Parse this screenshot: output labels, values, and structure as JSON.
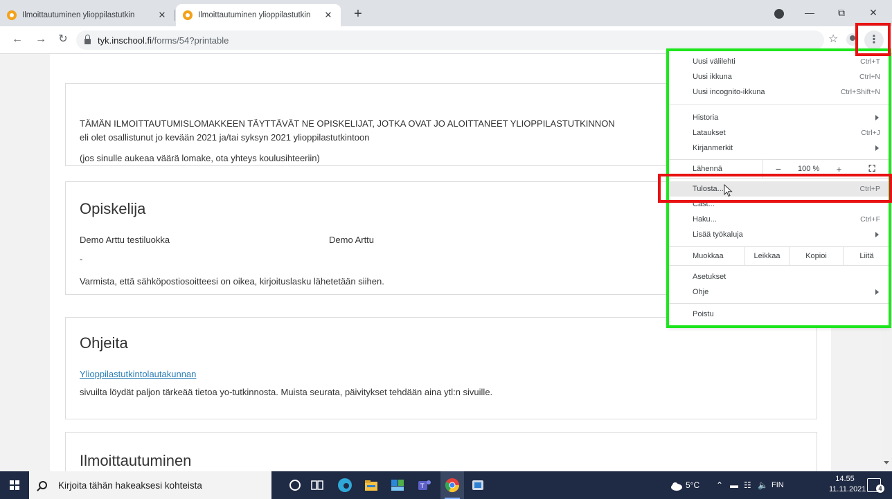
{
  "browser": {
    "tabs": [
      {
        "title": "Ilmoittautuminen ylioppilastutkin",
        "active": false
      },
      {
        "title": "Ilmoittautuminen ylioppilastutkin",
        "active": true
      }
    ],
    "tab_close_glyph": "✕",
    "new_tab_glyph": "+",
    "url_host": "tyk.inschool.fi",
    "url_path": "/forms/54?printable",
    "icons": [
      "back-icon",
      "forward-icon",
      "reload-icon",
      "lock-icon",
      "star-icon",
      "account-icon",
      "kebab-menu-icon",
      "minimize-icon",
      "restore-icon",
      "close-window-icon"
    ],
    "highlight_colors": {
      "red": "#e81212",
      "green": "#1ee61e"
    }
  },
  "page": {
    "intro": {
      "line1": "TÄMÄN ILMOITTAUTUMISLOMAKKEEN TÄYTTÄVÄT NE OPISKELIJAT, JOTKA OVAT JO ALOITTANEET YLIOPPILASTUTKINNON",
      "line2": "eli olet osallistunut jo kevään 2021 ja/tai syksyn 2021 ylioppilastutkintoon",
      "line3": "(jos sinulle aukeaa väärä lomake, ota yhteys koulusihteeriin)"
    },
    "student": {
      "heading": "Opiskelija",
      "class_name": "Demo Arttu testiluokka",
      "name": "Demo Arttu",
      "dash": "-",
      "email_note": "Varmista, että sähköpostiosoitteesi on oikea, kirjoituslasku lähetetään siihen."
    },
    "instructions": {
      "heading": "Ohjeita",
      "link": "Ylioppilastutkintolautakunnan",
      "text": "sivuilta löydät paljon tärkeää tietoa yo-tutkinnosta. Muista seurata, päivitykset tehdään aina ytl:n sivuille."
    },
    "registration": {
      "heading": "Ilmoittautuminen"
    }
  },
  "menu": {
    "new_tab": {
      "label": "Uusi välilehti",
      "shortcut": "Ctrl+T"
    },
    "new_window": {
      "label": "Uusi ikkuna",
      "shortcut": "Ctrl+N"
    },
    "incognito": {
      "label": "Uusi incognito-ikkuna",
      "shortcut": "Ctrl+Shift+N"
    },
    "history": {
      "label": "Historia"
    },
    "downloads": {
      "label": "Lataukset",
      "shortcut": "Ctrl+J"
    },
    "bookmarks": {
      "label": "Kirjanmerkit"
    },
    "zoom": {
      "label": "Lähennä",
      "minus": "−",
      "value": "100 %",
      "plus": "+"
    },
    "print": {
      "label": "Tulosta...",
      "shortcut": "Ctrl+P"
    },
    "cast": {
      "label": "Cast..."
    },
    "find": {
      "label": "Haku...",
      "shortcut": "Ctrl+F"
    },
    "more_tools": {
      "label": "Lisää työkaluja"
    },
    "edit": {
      "label": "Muokkaa",
      "cut": "Leikkaa",
      "copy": "Kopioi",
      "paste": "Liitä"
    },
    "settings": {
      "label": "Asetukset"
    },
    "help": {
      "label": "Ohje"
    },
    "exit": {
      "label": "Poistu"
    }
  },
  "taskbar": {
    "search_placeholder": "Kirjoita tähän hakeaksesi kohteista",
    "temperature": "5°C",
    "language": "FIN",
    "time": "14.55",
    "date": "11.11.2021",
    "notification_count": "4"
  }
}
